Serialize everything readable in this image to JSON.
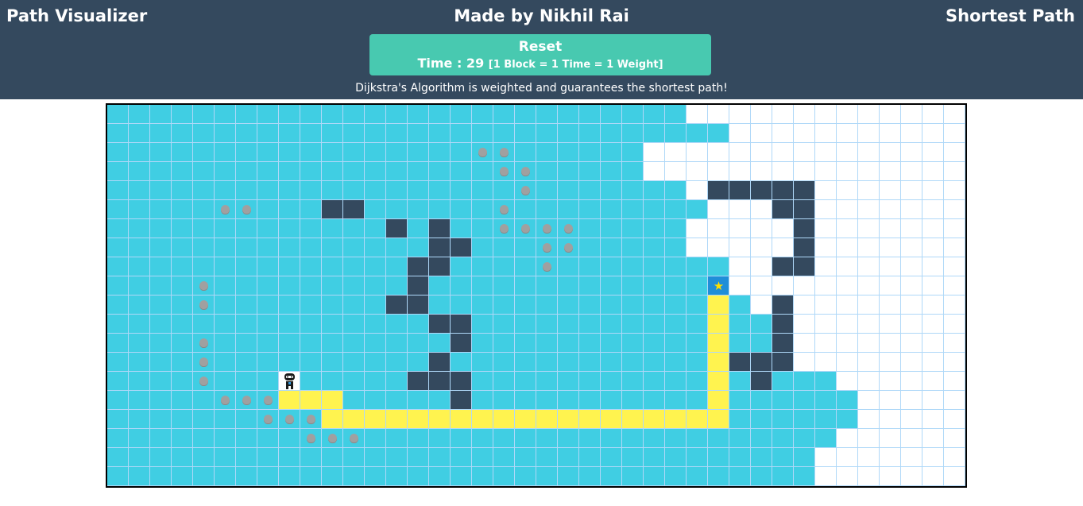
{
  "header": {
    "left_title": "Path Visualizer",
    "center_title": "Made by Nikhil Rai",
    "right_title": "Shortest Path",
    "reset_label": "Reset",
    "time_label": "Time : 29",
    "time_note": "[1 Block = 1 Time = 1 Weight]",
    "info_text": "Dijkstra's Algorithm is weighted and guarantees the shortest path!"
  },
  "grid": {
    "rows": 20,
    "cols": 40,
    "start": [
      14,
      8
    ],
    "target": [
      9,
      28
    ],
    "visited_extent": [
      26,
      28,
      24,
      24,
      26,
      27,
      26,
      26,
      28,
      28,
      29,
      31,
      31,
      31,
      33,
      34,
      34,
      33,
      32,
      32
    ],
    "walls": [
      [
        5,
        10
      ],
      [
        5,
        11
      ],
      [
        6,
        13
      ],
      [
        6,
        15
      ],
      [
        7,
        15
      ],
      [
        7,
        16
      ],
      [
        8,
        14
      ],
      [
        8,
        15
      ],
      [
        9,
        14
      ],
      [
        10,
        13
      ],
      [
        10,
        14
      ],
      [
        11,
        15
      ],
      [
        11,
        16
      ],
      [
        12,
        16
      ],
      [
        13,
        15
      ],
      [
        14,
        14
      ],
      [
        14,
        15
      ],
      [
        14,
        16
      ],
      [
        15,
        16
      ],
      [
        4,
        28
      ],
      [
        4,
        29
      ],
      [
        4,
        30
      ],
      [
        4,
        31
      ],
      [
        4,
        32
      ],
      [
        5,
        31
      ],
      [
        5,
        32
      ],
      [
        6,
        32
      ],
      [
        7,
        32
      ],
      [
        8,
        31
      ],
      [
        8,
        32
      ],
      [
        10,
        31
      ],
      [
        11,
        31
      ],
      [
        12,
        31
      ],
      [
        13,
        29
      ],
      [
        13,
        30
      ],
      [
        13,
        31
      ],
      [
        14,
        30
      ]
    ],
    "weights": [
      [
        2,
        17
      ],
      [
        2,
        18
      ],
      [
        3,
        18
      ],
      [
        3,
        19
      ],
      [
        4,
        19
      ],
      [
        5,
        5
      ],
      [
        5,
        6
      ],
      [
        5,
        18
      ],
      [
        6,
        18
      ],
      [
        6,
        19
      ],
      [
        6,
        20
      ],
      [
        6,
        21
      ],
      [
        7,
        20
      ],
      [
        7,
        21
      ],
      [
        8,
        20
      ],
      [
        9,
        4
      ],
      [
        10,
        4
      ],
      [
        12,
        4
      ],
      [
        13,
        4
      ],
      [
        14,
        4
      ],
      [
        15,
        5
      ],
      [
        15,
        6
      ],
      [
        15,
        7
      ],
      [
        16,
        7
      ],
      [
        16,
        8
      ],
      [
        16,
        9
      ],
      [
        17,
        9
      ],
      [
        17,
        10
      ],
      [
        17,
        11
      ]
    ],
    "path": [
      [
        15,
        8
      ],
      [
        15,
        9
      ],
      [
        15,
        10
      ],
      [
        16,
        10
      ],
      [
        16,
        11
      ],
      [
        16,
        12
      ],
      [
        16,
        13
      ],
      [
        16,
        14
      ],
      [
        16,
        15
      ],
      [
        16,
        16
      ],
      [
        16,
        17
      ],
      [
        16,
        18
      ],
      [
        16,
        19
      ],
      [
        16,
        20
      ],
      [
        16,
        21
      ],
      [
        16,
        22
      ],
      [
        16,
        23
      ],
      [
        16,
        24
      ],
      [
        16,
        25
      ],
      [
        16,
        26
      ],
      [
        16,
        27
      ],
      [
        16,
        28
      ],
      [
        15,
        28
      ],
      [
        14,
        28
      ],
      [
        13,
        28
      ],
      [
        12,
        28
      ],
      [
        11,
        28
      ],
      [
        10,
        28
      ]
    ]
  },
  "icons": {
    "start": "robot-icon",
    "target": "star-icon",
    "weight": "weight-icon"
  }
}
